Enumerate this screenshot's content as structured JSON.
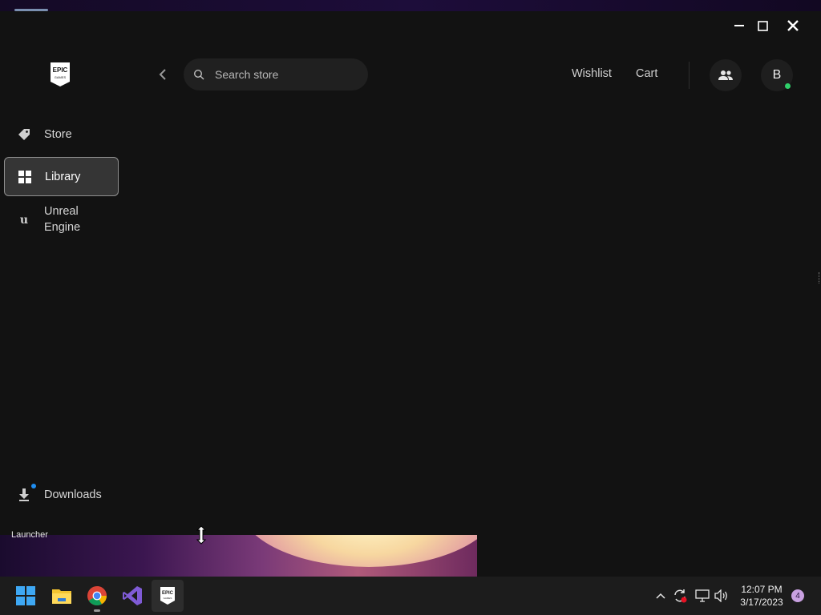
{
  "app": {
    "search": {
      "placeholder": "Search store"
    },
    "header_links": {
      "wishlist": "Wishlist",
      "cart": "Cart"
    },
    "avatar_initial": "B",
    "online_status_color": "#2fd06a"
  },
  "sidebar": {
    "items": [
      {
        "label": "Store",
        "icon": "tag-icon",
        "selected": false
      },
      {
        "label": "Library",
        "icon": "grid-icon",
        "selected": true
      },
      {
        "label": "Unreal\nEngine",
        "icon": "unreal-engine-icon",
        "selected": false
      }
    ],
    "downloads": {
      "label": "Downloads",
      "icon": "download-icon",
      "has_notification": true
    }
  },
  "desktop": {
    "launcher_label": "Launcher"
  },
  "taskbar": {
    "apps": [
      "start",
      "file-explorer",
      "chrome",
      "visual-studio",
      "epic-games-launcher"
    ],
    "clock": {
      "time": "12:07 PM",
      "date": "3/17/2023"
    },
    "notification_count": "4"
  },
  "colors": {
    "accent_blue": "#1f8ef1",
    "selected_bg": "#353535",
    "window_bg": "#121212"
  }
}
